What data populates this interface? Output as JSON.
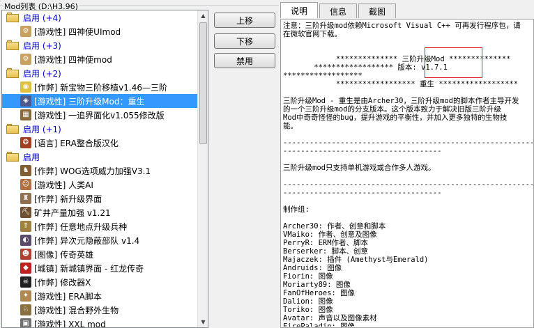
{
  "window": {
    "group_title": "Mod列表 (D:\\H3.96)"
  },
  "mod_list": {
    "rows": [
      {
        "kind": "group",
        "label": "启用 (+4)"
      },
      {
        "kind": "item",
        "label": "[游戏性] 四神使UImod",
        "icon": "gear-icon",
        "icon_color": "#c8a060",
        "glyph": "⚙"
      },
      {
        "kind": "group",
        "label": "启用 (+3)"
      },
      {
        "kind": "item",
        "label": "[游戏性] 四神使mod",
        "icon": "gear-icon",
        "icon_color": "#c8a060",
        "glyph": "⚙"
      },
      {
        "kind": "group",
        "label": "启用 (+2)"
      },
      {
        "kind": "item",
        "label": "[作弊] 新宝物三阶移植v1.46—三阶",
        "icon": "dragon-icon",
        "icon_color": "#e0c040",
        "glyph": "◉"
      },
      {
        "kind": "item",
        "label": "[游戏性] 三阶升级Mod：重生",
        "icon": "shield-icon",
        "icon_color": "#4a5a8a",
        "glyph": "◈",
        "selected": true
      },
      {
        "kind": "item",
        "label": "[游戏性] 一追界面化v1.055修改版",
        "icon": "map-icon",
        "icon_color": "#8a6a3a",
        "glyph": "▦"
      },
      {
        "kind": "group",
        "label": "启用 (+1)"
      },
      {
        "kind": "item",
        "label": "[语言] ERA整合版汉化",
        "icon": "seal-icon",
        "icon_color": "#a04020",
        "glyph": "❂"
      },
      {
        "kind": "group",
        "label": "启用"
      },
      {
        "kind": "item",
        "label": "[作弊] WOG选项威力加强V3.1",
        "icon": "knight-icon",
        "icon_color": "#806030",
        "glyph": "♞"
      },
      {
        "kind": "item",
        "label": "[游戏性] 人类AI",
        "icon": "head-icon",
        "icon_color": "#b07040",
        "glyph": "☺"
      },
      {
        "kind": "item",
        "label": "[作弊] 新升级界面",
        "icon": "castle-icon",
        "icon_color": "#907050",
        "glyph": "♜"
      },
      {
        "kind": "item",
        "label": "矿井产量加强 v1.21",
        "icon": "mine-icon",
        "icon_color": "#705030",
        "glyph": "⛏"
      },
      {
        "kind": "item",
        "label": "[作弊] 任意地点升级兵种",
        "icon": "arrows-icon",
        "icon_color": "#a08040",
        "glyph": "⇑"
      },
      {
        "kind": "item",
        "label": "[作弊] 异次元隐蔽部队 v1.4",
        "icon": "ghost-icon",
        "icon_color": "#5a4a6a",
        "glyph": "◐"
      },
      {
        "kind": "item",
        "label": "[图像] 传奇英雄",
        "icon": "hero-icon",
        "icon_color": "#b04030",
        "glyph": "☻"
      },
      {
        "kind": "item",
        "label": "[城镇] 新城镇界面 - 红龙传奇",
        "icon": "red-dragon-icon",
        "icon_color": "#c02020",
        "glyph": "◆"
      },
      {
        "kind": "item",
        "label": "[作弊] 修改器X",
        "icon": "skull-icon",
        "icon_color": "#202020",
        "glyph": "☠"
      },
      {
        "kind": "item",
        "label": "[游戏性] ERA脚本",
        "icon": "scroll-icon",
        "icon_color": "#b08850",
        "glyph": "✦"
      },
      {
        "kind": "item",
        "label": "[游戏性] 混合野外生物",
        "icon": "creature-icon",
        "icon_color": "#8a7040",
        "glyph": "♘"
      },
      {
        "kind": "item",
        "label": "[游戏性] XXL mod",
        "icon": "misc-icon",
        "icon_color": "#707070",
        "glyph": "▣"
      }
    ]
  },
  "buttons": {
    "move_up": "上移",
    "move_down": "下移",
    "disable": "禁用"
  },
  "tabs": {
    "description": "说明",
    "info": "信息",
    "screenshot": "截图"
  },
  "description_text": "注意：三阶升级mod依赖Microsoft Visual C++ 可再发行程序包，请\n在微软官网下载。\n\n\n            ************** 三阶升级Mod **************\n       ****************** 版本: v1.7.1\n******************\n            ****************** 重生 ******************\n\n三阶升级Mod - 重生是由Archer30，三阶升级mod的脚本作者主导开发\n的一个三阶升级mod的分支版本。这个版本致力于解决旧版三阶升级\nMod中奇奇怪怪的bug，提升游戏的平衡性，并加入更多独特的生物技\n能。\n\n----------------------------------------------------------------\n------------------------------------\n\n三阶升级mod只支持单机游戏或合作多人游戏。\n\n----------------------------------------------------------------\n------------------------------------\n\n制作组:\n\nArcher30: 作者、创意和脚本\nVMaiko: 作者、创意及图像\nPerryR: ERM作者、脚本\nBerserker: 脚本、创意\nMajaczek: 插件 (Amethyst与Emerald)\nAndruids: 图像\nFiorin: 图像\nMoriarty89: 图像\nFanOfHeroes: 图像\nDalion: 图像\nToriko: 图像\nAvatar: 声音以及图像素材\nFirePaladin: 图像"
}
